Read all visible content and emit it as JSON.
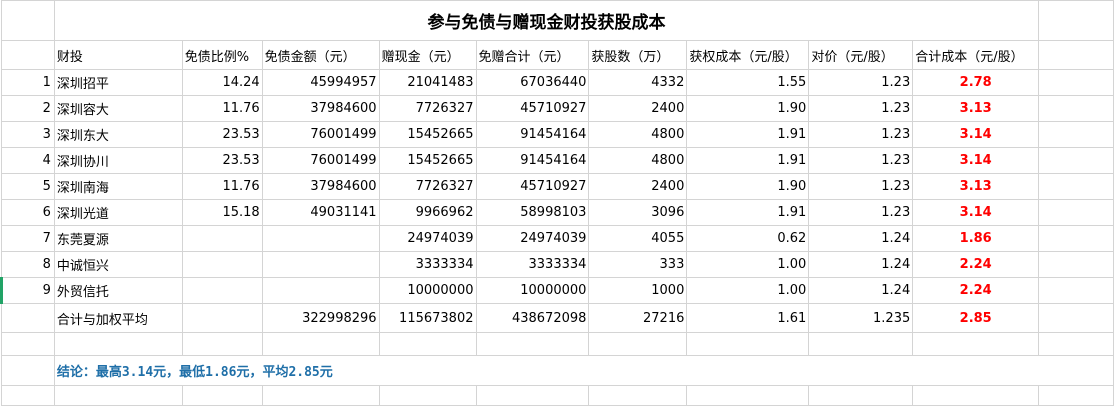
{
  "title": "参与免债与赠现金财投获股成本",
  "headers": [
    "财投",
    "免债比例%",
    "免债金额（元）",
    "赠现金（元）",
    "免赠合计（元）",
    "获股数（万）",
    "获权成本（元/股）",
    "对价（元/股）",
    "合计成本（元/股）"
  ],
  "rows": [
    {
      "idx": "1",
      "name": "深圳招平",
      "ratio": "14.24",
      "debt": "45994957",
      "cash": "21041483",
      "total": "67036440",
      "shares": "4332",
      "cost": "1.55",
      "price": "1.23",
      "sum_cost": "2.78"
    },
    {
      "idx": "2",
      "name": "深圳容大",
      "ratio": "11.76",
      "debt": "37984600",
      "cash": "7726327",
      "total": "45710927",
      "shares": "2400",
      "cost": "1.90",
      "price": "1.23",
      "sum_cost": "3.13"
    },
    {
      "idx": "3",
      "name": "深圳东大",
      "ratio": "23.53",
      "debt": "76001499",
      "cash": "15452665",
      "total": "91454164",
      "shares": "4800",
      "cost": "1.91",
      "price": "1.23",
      "sum_cost": "3.14"
    },
    {
      "idx": "4",
      "name": "深圳协川",
      "ratio": "23.53",
      "debt": "76001499",
      "cash": "15452665",
      "total": "91454164",
      "shares": "4800",
      "cost": "1.91",
      "price": "1.23",
      "sum_cost": "3.14"
    },
    {
      "idx": "5",
      "name": "深圳南海",
      "ratio": "11.76",
      "debt": "37984600",
      "cash": "7726327",
      "total": "45710927",
      "shares": "2400",
      "cost": "1.90",
      "price": "1.23",
      "sum_cost": "3.13"
    },
    {
      "idx": "6",
      "name": "深圳光道",
      "ratio": "15.18",
      "debt": "49031141",
      "cash": "9966962",
      "total": "58998103",
      "shares": "3096",
      "cost": "1.91",
      "price": "1.23",
      "sum_cost": "3.14"
    },
    {
      "idx": "7",
      "name": "东莞夏源",
      "ratio": "",
      "debt": "",
      "cash": "24974039",
      "total": "24974039",
      "shares": "4055",
      "cost": "0.62",
      "price": "1.24",
      "sum_cost": "1.86"
    },
    {
      "idx": "8",
      "name": "中诚恒兴",
      "ratio": "",
      "debt": "",
      "cash": "3333334",
      "total": "3333334",
      "shares": "333",
      "cost": "1.00",
      "price": "1.24",
      "sum_cost": "2.24"
    },
    {
      "idx": "9",
      "name": "外贸信托",
      "ratio": "",
      "debt": "",
      "cash": "10000000",
      "total": "10000000",
      "shares": "1000",
      "cost": "1.00",
      "price": "1.24",
      "sum_cost": "2.24"
    }
  ],
  "summary": {
    "label": "合计与加权平均",
    "debt": "322998296",
    "cash": "115673802",
    "total": "438672098",
    "shares": "27216",
    "cost": "1.61",
    "price": "1.235",
    "sum_cost": "2.85"
  },
  "conclusion": "结论：最高3.14元，最低1.86元，平均2.85元",
  "colors": {
    "cost_red": "#ff0000",
    "conclusion_blue": "#1f6fa8",
    "grid": "#d4d4d4",
    "active_row_marker": "#21a366"
  }
}
